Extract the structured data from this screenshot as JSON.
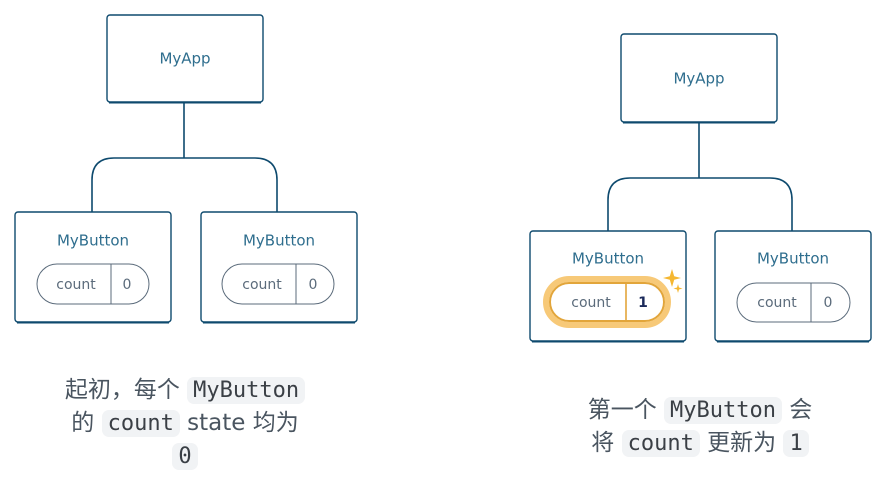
{
  "diagram_left": {
    "root_label": "MyApp",
    "children": [
      {
        "label": "MyButton",
        "state_name": "count",
        "state_value": "0"
      },
      {
        "label": "MyButton",
        "state_name": "count",
        "state_value": "0"
      }
    ]
  },
  "diagram_right": {
    "root_label": "MyApp",
    "children": [
      {
        "label": "MyButton",
        "state_name": "count",
        "state_value": "1",
        "highlighted": true
      },
      {
        "label": "MyButton",
        "state_name": "count",
        "state_value": "0"
      }
    ]
  },
  "caption_left": {
    "line1_text": "起初，每个",
    "line1_code": "MyButton",
    "line2_text1": "的",
    "line2_code": "count",
    "line2_text2": "state 均为",
    "line3_code": "0"
  },
  "caption_right": {
    "line1_text1": "第一个",
    "line1_code": "MyButton",
    "line1_text2": "会",
    "line2_text1": "将",
    "line2_code": "count",
    "line2_text2": "更新为",
    "line2_code2": "1"
  },
  "colors": {
    "box_stroke": "#0e4a6e",
    "label_text": "#2f6e8e",
    "highlight": "#e2a53a",
    "sparkle": "#f5b731"
  }
}
